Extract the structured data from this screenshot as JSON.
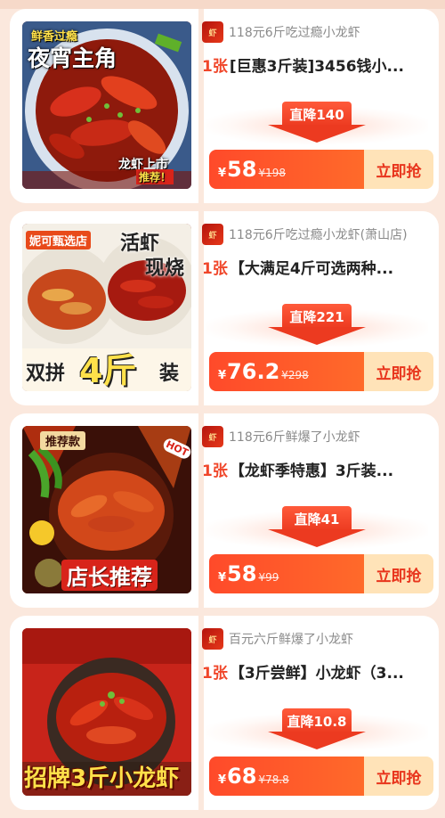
{
  "colors": {
    "page_bg": "#fbe8dd",
    "accent_red": "#f0462a",
    "grab_bg": "#ffe3b8",
    "grab_text": "#e8341c"
  },
  "cards": [
    {
      "shop_name": "118元6斤吃过瘾小龙虾",
      "qty_label": "1张",
      "title": "[巨惠3斤装]3456钱小...",
      "drop_label": "直降140",
      "yen": "¥",
      "price": "58",
      "orig_price": "¥198",
      "grab_label": "立即抢",
      "img_captions": [
        "鲜香过瘾",
        "夜宵主角",
        "龙虾上市",
        "推荐！"
      ]
    },
    {
      "shop_name": "118元6斤吃过瘾小龙虾(萧山店)",
      "qty_label": "1张",
      "title": "【大满足4斤可选两种...",
      "drop_label": "直降221",
      "yen": "¥",
      "price": "76.2",
      "orig_price": "¥298",
      "grab_label": "立即抢",
      "img_captions": [
        "妮可甄选店",
        "活虾",
        "现烧",
        "双拼",
        "4斤",
        "装"
      ]
    },
    {
      "shop_name": "118元6斤鲜爆了小龙虾",
      "qty_label": "1张",
      "title": "【龙虾季特惠】3斤装...",
      "drop_label": "直降41",
      "yen": "¥",
      "price": "58",
      "orig_price": "¥99",
      "grab_label": "立即抢",
      "img_captions": [
        "推荐款",
        "HOT",
        "店长推荐"
      ]
    },
    {
      "shop_name": "百元六斤鲜爆了小龙虾",
      "qty_label": "1张",
      "title": "【3斤尝鲜】小龙虾（3...",
      "drop_label": "直降10.8",
      "yen": "¥",
      "price": "68",
      "orig_price": "¥78.8",
      "grab_label": "立即抢",
      "img_captions": [
        "招牌3斤小龙虾"
      ]
    }
  ]
}
